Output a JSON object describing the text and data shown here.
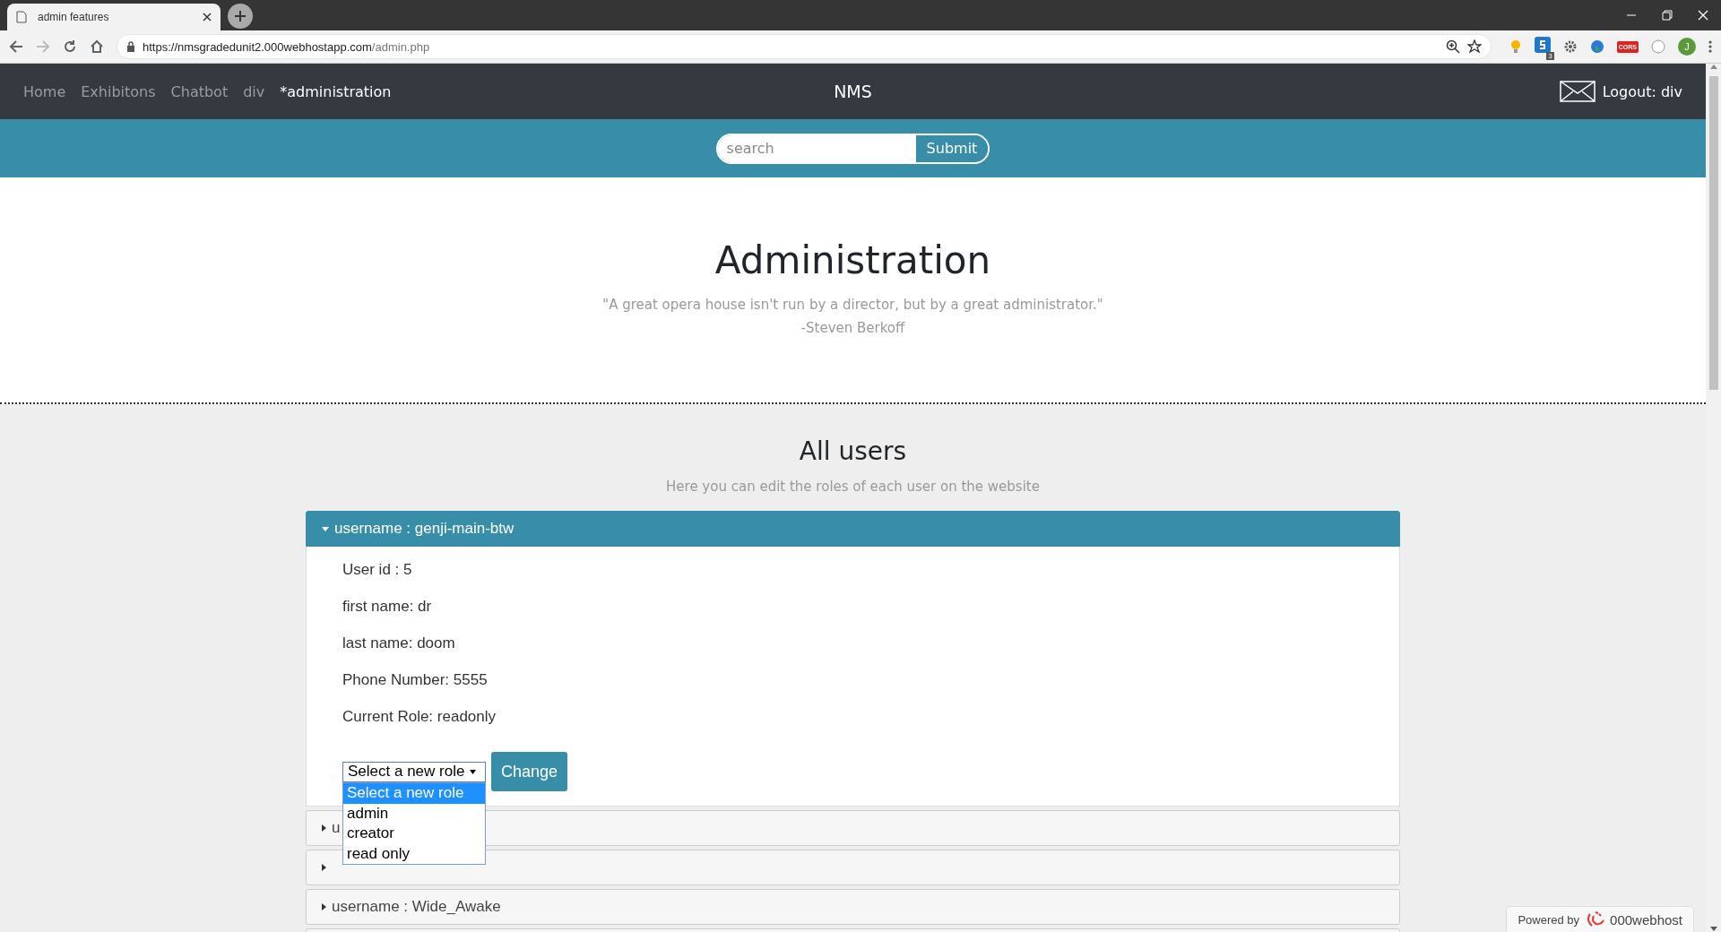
{
  "browser": {
    "tab_title": "admin features",
    "url_host": "https://nmsgradedunit2.000webhostapp.com",
    "url_path": "/admin.php",
    "extension_badge": "3",
    "cors_label": "CORS",
    "profile_initial": "J"
  },
  "nav": {
    "links": [
      {
        "label": "Home",
        "selected": false
      },
      {
        "label": "Exhibitons",
        "selected": false
      },
      {
        "label": "Chatbot",
        "selected": false
      },
      {
        "label": "div",
        "selected": false
      },
      {
        "label": "*administration",
        "selected": true
      }
    ],
    "brand": "NMS",
    "logout": "Logout: div"
  },
  "search": {
    "placeholder": "search",
    "button": "Submit"
  },
  "hero": {
    "title": "Administration",
    "quote": "\"A great opera house isn't run by a director, but by a great administrator.\"",
    "author": "-Steven Berkoff"
  },
  "users": {
    "title": "All users",
    "subtitle": "Here you can edit the roles of each user on the website",
    "accordion": [
      {
        "label": "username : genji-main-btw",
        "expanded": true,
        "details": [
          "User id : 5",
          "first name: dr",
          "last name: doom",
          "Phone Number: 5555",
          "Current Role: readonly"
        ],
        "role_select": {
          "value": "Select a new role",
          "options": [
            {
              "label": "Select a new role",
              "selected": true
            },
            {
              "label": "admin",
              "selected": false
            },
            {
              "label": "creator",
              "selected": false
            },
            {
              "label": "read only",
              "selected": false
            }
          ]
        },
        "button": "Change"
      },
      {
        "label": "u",
        "expanded": false
      },
      {
        "expanded": false
      },
      {
        "label": "username : Wide_Awake",
        "expanded": false
      },
      {
        "expanded": false
      }
    ]
  },
  "footer_badge": {
    "prefix": "Powered by",
    "brand": "000webhost"
  }
}
